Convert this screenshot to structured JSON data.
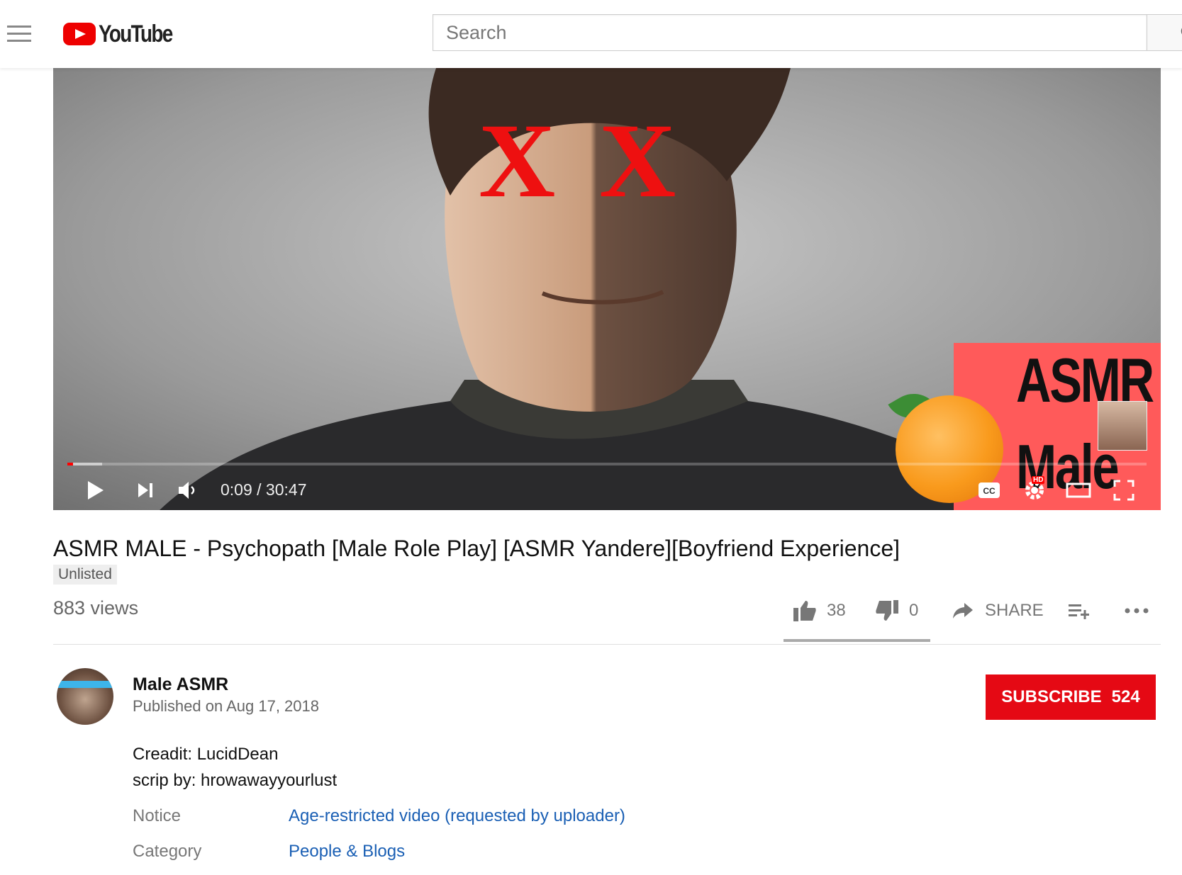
{
  "header": {
    "logo_text": "YouTube",
    "search_placeholder": "Search"
  },
  "player": {
    "time_current": "0:09",
    "time_total": "30:47",
    "time_display": "0:09 / 30:47",
    "progress_fraction": 0.005,
    "buffered_fraction": 0.032,
    "thumbnail_overlay_text": "ASMR Male",
    "hd_badge": "HD",
    "colors": {
      "progress": "#ff0000",
      "overlay_box": "#ff5a5a"
    }
  },
  "video": {
    "title": "ASMR MALE - Psychopath [Male Role Play] [ASMR Yandere][Boyfriend Experience]",
    "visibility_badge": "Unlisted",
    "views": "883 views",
    "likes": "38",
    "dislikes": "0",
    "share_label": "SHARE"
  },
  "channel": {
    "name": "Male ASMR",
    "published": "Published on Aug 17, 2018",
    "subscribe_label": "SUBSCRIBE",
    "subscriber_count": "524",
    "colors": {
      "subscribe": "#e50914"
    }
  },
  "description": {
    "lines": [
      "Creadit: LucidDean",
      "scrip by: hrowawayyourlust"
    ],
    "meta": [
      {
        "label": "Notice",
        "value": "Age-restricted video (requested by uploader)"
      },
      {
        "label": "Category",
        "value": "People & Blogs"
      }
    ]
  }
}
